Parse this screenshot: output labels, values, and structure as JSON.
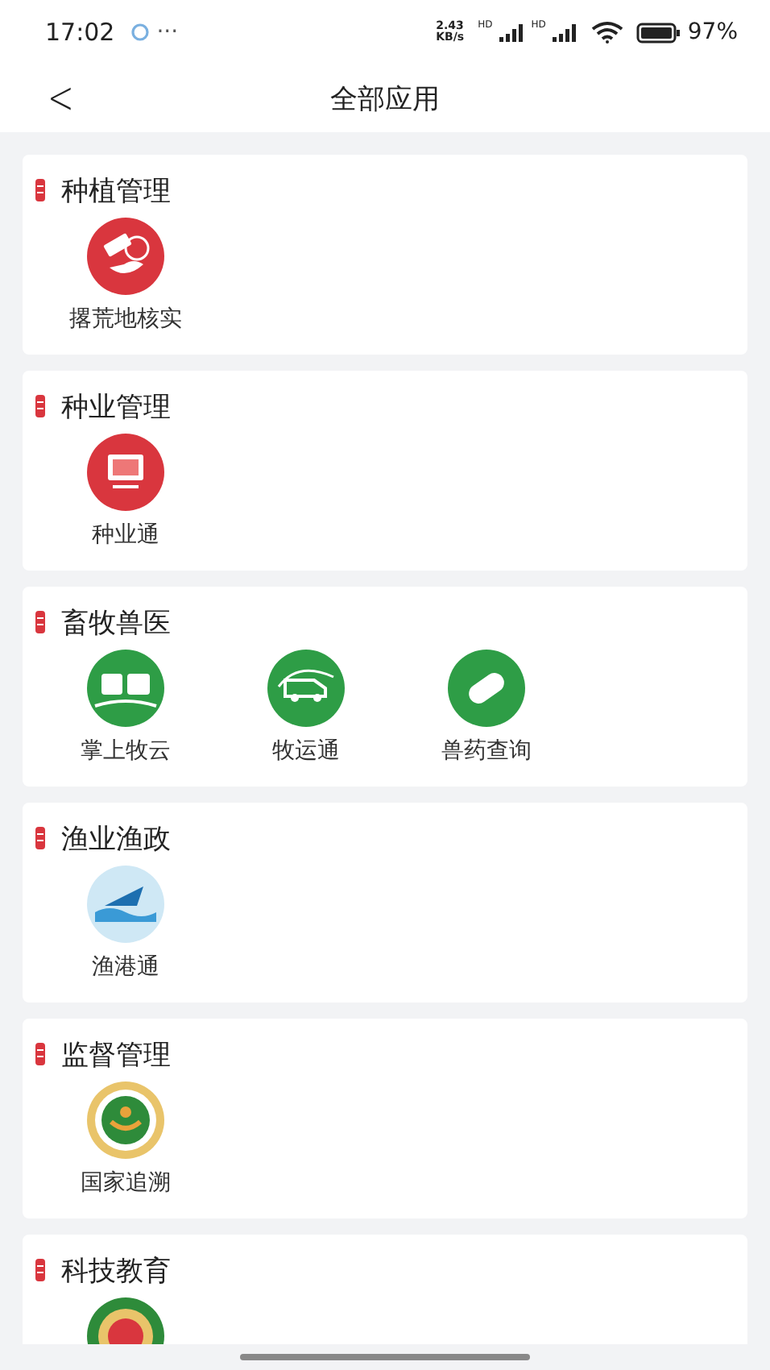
{
  "status_bar": {
    "time": "17:02",
    "dots": "···",
    "speed": "2.43 KB/s",
    "network_1": "HD",
    "network_2": "HD",
    "battery": "97%"
  },
  "header": {
    "back": "<",
    "title": "全部应用"
  },
  "sections": [
    {
      "title": "种植管理",
      "apps": [
        {
          "kind": "satellite",
          "label": "撂荒地核实"
        }
      ]
    },
    {
      "title": "种业管理",
      "apps": [
        {
          "kind": "monitor",
          "label": "种业通"
        }
      ]
    },
    {
      "title": "畜牧兽医",
      "apps": [
        {
          "kind": "cloud",
          "label": "掌上牧云"
        },
        {
          "kind": "truck",
          "label": "牧运通"
        },
        {
          "kind": "pill",
          "label": "兽药查询"
        }
      ]
    },
    {
      "title": "渔业渔政",
      "apps": [
        {
          "kind": "ship",
          "label": "渔港通"
        }
      ]
    },
    {
      "title": "监督管理",
      "apps": [
        {
          "kind": "emblem",
          "label": "国家追溯"
        }
      ]
    },
    {
      "title": "科技教育",
      "apps": [
        {
          "kind": "badge"
        }
      ]
    }
  ]
}
